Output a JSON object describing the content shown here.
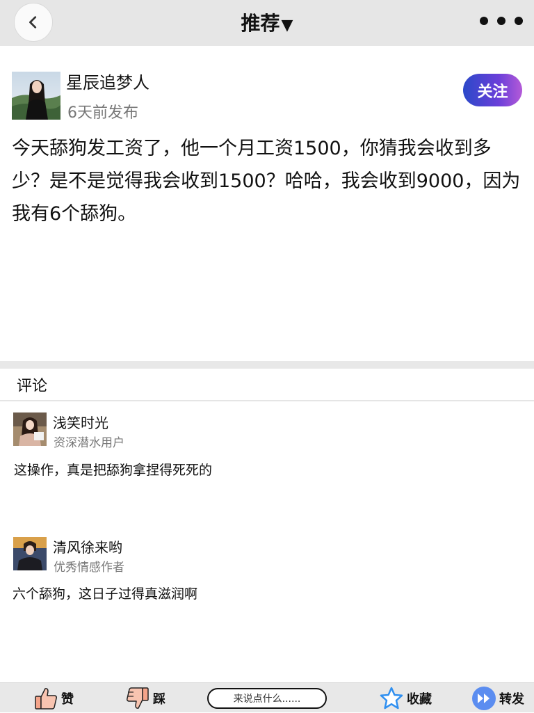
{
  "header": {
    "title": "推荐",
    "caret": "▼"
  },
  "post": {
    "author": "星辰追梦人",
    "time": "6天前发布",
    "follow_label": "关注",
    "content": "今天舔狗发工资了，他一个月工资1500，你猜我会收到多少？是不是觉得我会收到1500？哈哈，我会收到9000，因为我有6个舔狗。"
  },
  "comments_section": {
    "heading": "评论",
    "items": [
      {
        "name": "浅笑时光",
        "role": "资深潜水用户",
        "text": "这操作，真是把舔狗拿捏得死死的"
      },
      {
        "name": "清风徐来哟",
        "role": "优秀情感作者",
        "text": "六个舔狗，这日子过得真滋润啊"
      }
    ]
  },
  "bottom_bar": {
    "like_label": "赞",
    "dislike_label": "踩",
    "input_placeholder": "来说点什么......",
    "favorite_label": "收藏",
    "share_label": "转发"
  },
  "colors": {
    "follow_gradient_start": "#2b49c9",
    "follow_gradient_end": "#b45ad8",
    "like_icon": "#f4a48a",
    "star_icon": "#2f8ff0",
    "share_icon": "#5b8df0"
  },
  "icons": [
    "back-chevron-icon",
    "more-dots-icon",
    "thumbs-up-icon",
    "thumbs-down-icon",
    "star-icon",
    "fast-forward-icon"
  ]
}
